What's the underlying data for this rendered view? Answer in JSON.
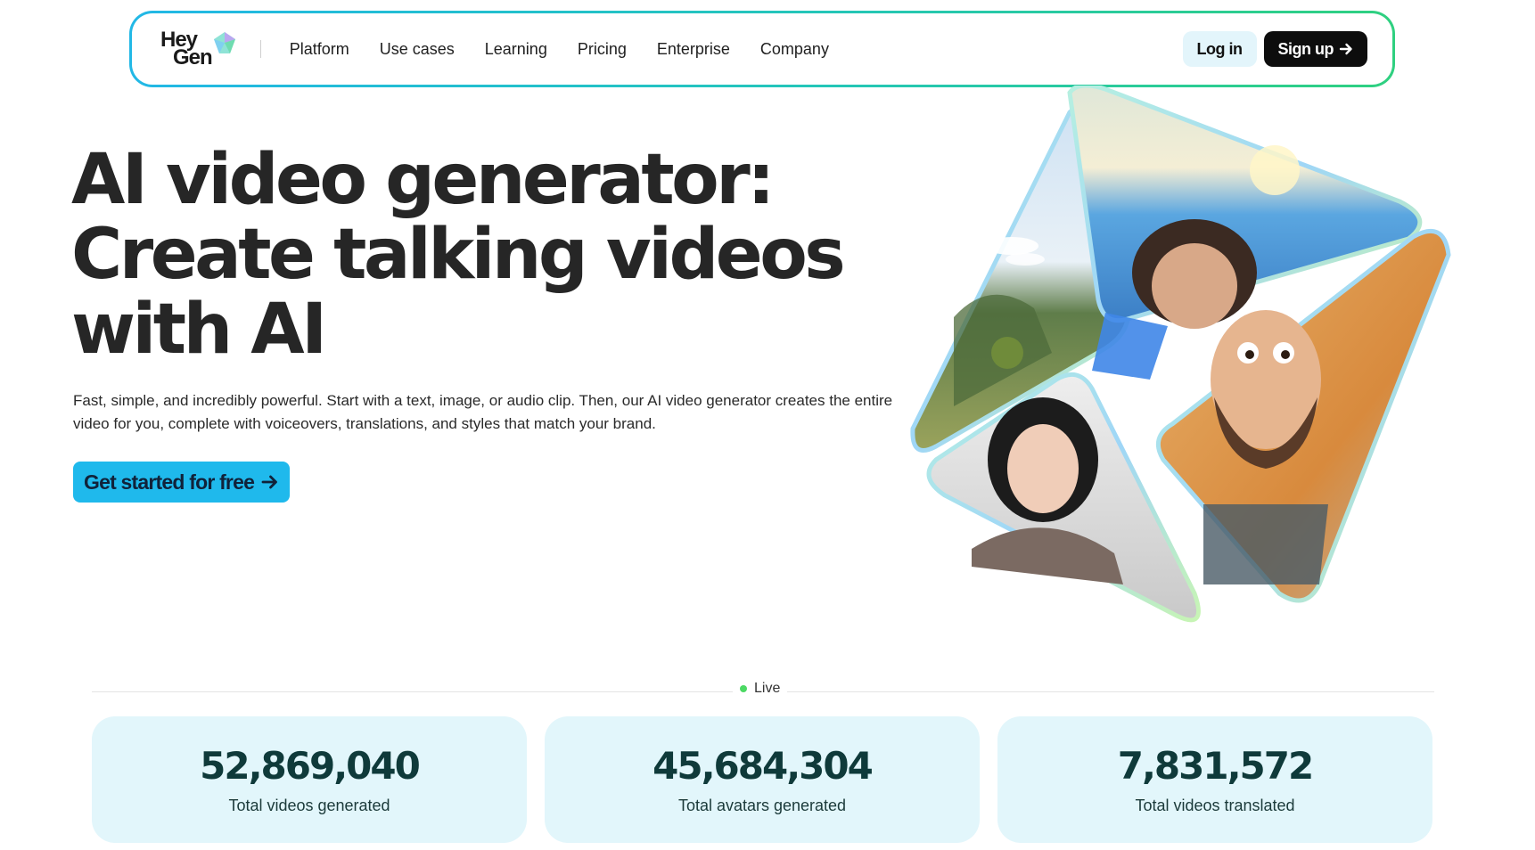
{
  "nav": {
    "logo_line1": "Hey",
    "logo_line2": "Gen",
    "links": [
      "Platform",
      "Use cases",
      "Learning",
      "Pricing",
      "Enterprise",
      "Company"
    ],
    "login_label": "Log in",
    "signup_label": "Sign up"
  },
  "hero": {
    "title_line1": "AI video generator:",
    "title_line2": "Create talking videos",
    "title_line3": "with AI",
    "subtitle": "Fast, simple, and incredibly powerful. Start with a text, image, or audio clip. Then, our AI video generator creates the entire video for you, complete with voiceovers, translations, and styles that match your brand.",
    "cta_label": "Get started for free"
  },
  "live": {
    "label": "Live"
  },
  "stats": [
    {
      "value": "52,869,040",
      "label": "Total videos generated"
    },
    {
      "value": "45,684,304",
      "label": "Total avatars generated"
    },
    {
      "value": "7,831,572",
      "label": "Total videos translated"
    }
  ],
  "colors": {
    "brand_border_start": "#22b8e6",
    "brand_border_end": "#2fd080",
    "cta": "#1fb9ec",
    "stat_card": "#e2f6fb",
    "live_dot": "#4cd964"
  }
}
